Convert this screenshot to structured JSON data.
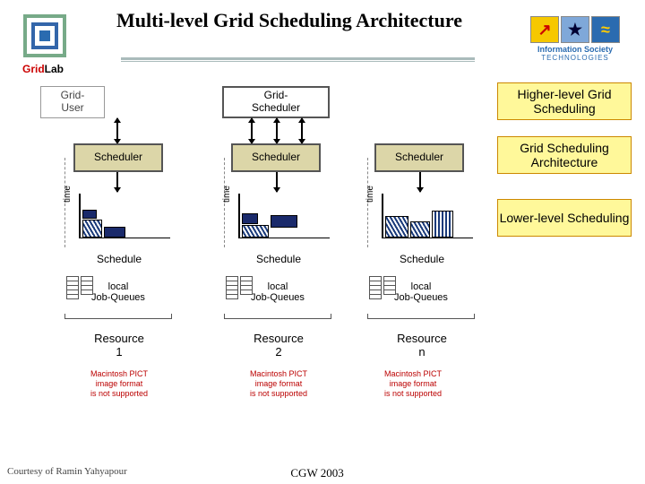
{
  "title": "Multi-level Grid Scheduling Architecture",
  "logo_left": {
    "caption_a": "Grid",
    "caption_b": "Lab"
  },
  "logo_right": {
    "label": "Information Society",
    "sub": "TECHNOLOGIES"
  },
  "top": {
    "grid_user": "Grid-\nUser",
    "grid_scheduler": "Grid-\nScheduler"
  },
  "annotations": {
    "higher": "Higher-level Grid Scheduling",
    "arch": "Grid Scheduling Architecture",
    "lower": "Lower-level Scheduling"
  },
  "scheduler_label": "Scheduler",
  "time_label": "time",
  "schedule_label": "Schedule",
  "queue_label": "local\nJob-Queues",
  "resources": [
    "Resource\n1",
    "Resource\n2",
    "Resource\nn"
  ],
  "pict_error": "Macintosh PICT\nimage format\nis not supported",
  "footer": {
    "left": "Courtesy of Ramin Yahyapour",
    "center": "CGW 2003"
  }
}
